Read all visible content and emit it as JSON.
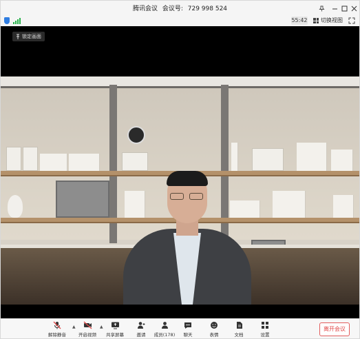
{
  "window": {
    "app_name": "腾讯会议",
    "meeting_id_label": "会议号:",
    "meeting_id": "729 998 524"
  },
  "status": {
    "timer": "55:42",
    "switch_view_label": "切换视图"
  },
  "video": {
    "lock_label": "锁定画面"
  },
  "toolbar": {
    "unmute": "解除静音",
    "start_video": "开启视频",
    "share_screen": "共享屏幕",
    "invite": "邀请",
    "members": "成员(178)",
    "chat": "聊天",
    "reactions": "表情",
    "docs": "文档",
    "settings": "设置",
    "leave": "离开会议"
  },
  "colors": {
    "shield": "#2f7de1",
    "signal": "#27b34a",
    "leave": "#e04848",
    "muted_icon": "#e04848"
  },
  "icons": {
    "unmute": "mic-muted-icon",
    "start_video": "camera-off-icon",
    "share_screen": "screen-share-icon",
    "invite": "add-user-icon",
    "members": "users-icon",
    "chat": "chat-icon",
    "reactions": "smile-icon",
    "docs": "document-icon",
    "settings": "grid-icon"
  }
}
